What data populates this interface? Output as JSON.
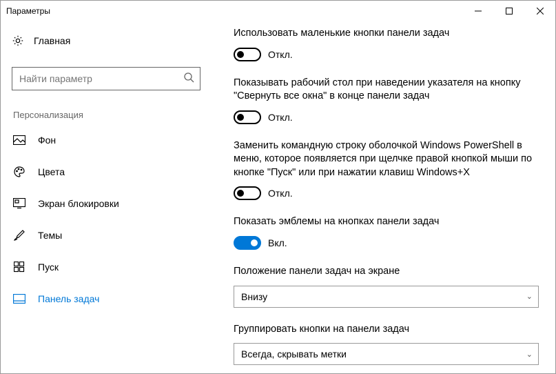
{
  "window": {
    "title": "Параметры"
  },
  "sidebar": {
    "home": "Главная",
    "searchPlaceholder": "Найти параметр",
    "section": "Персонализация",
    "items": [
      {
        "label": "Фон"
      },
      {
        "label": "Цвета"
      },
      {
        "label": "Экран блокировки"
      },
      {
        "label": "Темы"
      },
      {
        "label": "Пуск"
      },
      {
        "label": "Панель задач"
      }
    ]
  },
  "settings": [
    {
      "label": "Использовать маленькие кнопки панели задач",
      "state": "off",
      "stateText": "Откл."
    },
    {
      "label": "Показывать рабочий стол при наведении указателя на кнопку \"Свернуть все окна\" в конце панели задач",
      "state": "off",
      "stateText": "Откл."
    },
    {
      "label": "Заменить командную строку оболочкой Windows PowerShell в меню, которое появляется при щелчке правой кнопкой мыши по кнопке \"Пуск\" или при нажатии клавиш Windows+X",
      "state": "off",
      "stateText": "Откл."
    },
    {
      "label": "Показать эмблемы на кнопках панели задач",
      "state": "on",
      "stateText": "Вкл."
    }
  ],
  "dropdowns": [
    {
      "label": "Положение панели задач на экране",
      "value": "Внизу"
    },
    {
      "label": "Группировать кнопки на панели задач",
      "value": "Всегда, скрывать метки"
    }
  ]
}
